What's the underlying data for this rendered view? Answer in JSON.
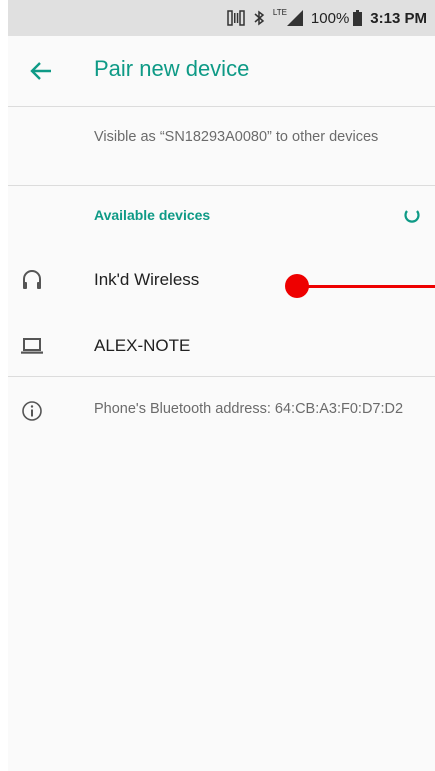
{
  "status_bar": {
    "signal_label": "LTE",
    "battery": "100%",
    "time": "3:13 PM"
  },
  "app_bar": {
    "title": "Pair new device"
  },
  "visible_as": "Visible as “SN18293A0080” to other devices",
  "available_devices": {
    "header": "Available devices",
    "devices": [
      {
        "name": "Ink'd Wireless",
        "icon": "headphones-icon"
      },
      {
        "name": "ALEX-NOTE",
        "icon": "laptop-icon"
      }
    ]
  },
  "bluetooth_address": {
    "text": "Phone's Bluetooth address: 64:CB:A3:F0:D7:D2",
    "icon": "info-icon"
  },
  "colors": {
    "accent": "#0e9a86",
    "annotation": "#ee0000"
  }
}
